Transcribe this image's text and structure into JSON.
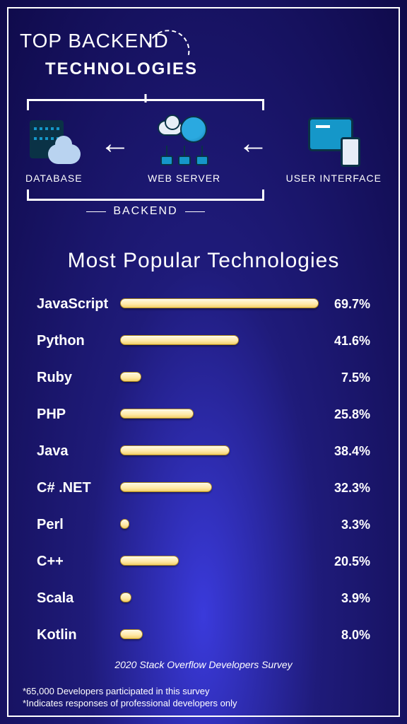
{
  "header": {
    "line1": "TOP BACKEND",
    "line2": "TECHNOLOGIES"
  },
  "arch": {
    "database": "DATABASE",
    "webserver": "WEB SERVER",
    "ui": "USER INTERFACE",
    "backend": "BACKEND"
  },
  "chart_title": "Most Popular Technologies",
  "chart_data": {
    "type": "bar",
    "categories": [
      "JavaScript",
      "Python",
      "Ruby",
      "PHP",
      "Java",
      "C# .NET",
      "Perl",
      "C++",
      "Scala",
      "Kotlin"
    ],
    "values": [
      69.7,
      41.6,
      7.5,
      25.8,
      38.4,
      32.3,
      3.3,
      20.5,
      3.9,
      8.0
    ],
    "display_pct": [
      "69.7%",
      "41.6%",
      "7.5%",
      "25.8%",
      "38.4%",
      "32.3%",
      "3.3%",
      "20.5%",
      "3.9%",
      "8.0%"
    ],
    "title": "Most Popular Technologies",
    "xlabel": "",
    "ylabel": "",
    "xlim": [
      0,
      70
    ]
  },
  "source": "2020 Stack Overflow Developers Survey",
  "footnotes": {
    "a": "*65,000 Developers participated in this survey",
    "b": "*Indicates responses of professional developers only"
  }
}
